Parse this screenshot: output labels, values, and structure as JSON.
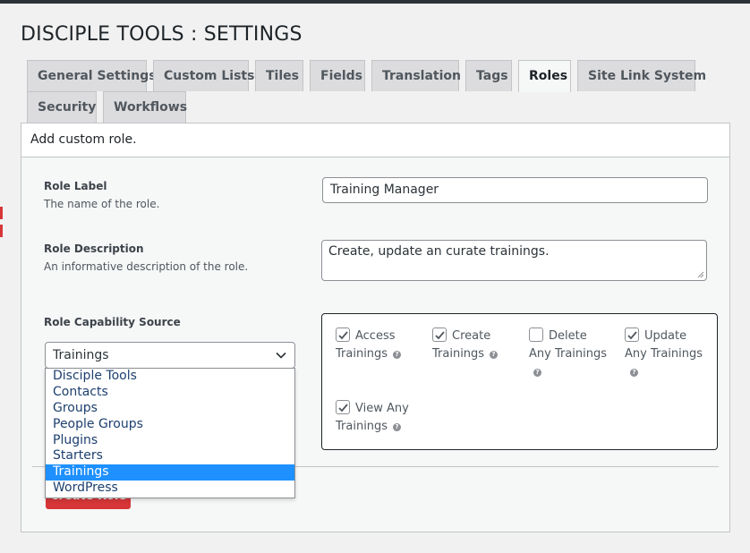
{
  "page": {
    "title": "DISCIPLE TOOLS : SETTINGS"
  },
  "tabs": [
    {
      "label": "General Settings"
    },
    {
      "label": "Custom Lists"
    },
    {
      "label": "Tiles"
    },
    {
      "label": "Fields"
    },
    {
      "label": "Translation"
    },
    {
      "label": "Tags"
    },
    {
      "label": "Roles",
      "active": true
    },
    {
      "label": "Site Link System"
    },
    {
      "label": "Security"
    },
    {
      "label": "Workflows"
    }
  ],
  "box": {
    "header": "Add custom role."
  },
  "form": {
    "role_label": {
      "label": "Role Label",
      "description": "The name of the role.",
      "value": "Training Manager"
    },
    "role_description": {
      "label": "Role Description",
      "description": "An informative description of the role.",
      "value": "Create, update an curate trainings."
    },
    "capability_source": {
      "label": "Role Capability Source",
      "selected": "Trainings",
      "options": [
        "Disciple Tools",
        "Contacts",
        "Groups",
        "People Groups",
        "Plugins",
        "Starters",
        "Trainings",
        "WordPress"
      ]
    }
  },
  "capabilities": [
    {
      "line1": "Access",
      "line2": "Trainings",
      "checked": true
    },
    {
      "line1": "Create",
      "line2": "Trainings",
      "checked": true
    },
    {
      "line1": "Delete",
      "line2": "Any Trainings",
      "checked": false
    },
    {
      "line1": "Update",
      "line2": "Any Trainings",
      "checked": true
    },
    {
      "line1": "View Any",
      "line2": "Trainings",
      "checked": true
    }
  ],
  "icons": {
    "help": "help-icon",
    "check": "checkmark-icon",
    "chevron": "chevron-down-icon"
  },
  "help_glyph": "?",
  "submit": {
    "label": "Create Role"
  },
  "colors": {
    "accent": "#1e90ff",
    "danger": "#d63638",
    "link": "#1d3f6e"
  }
}
